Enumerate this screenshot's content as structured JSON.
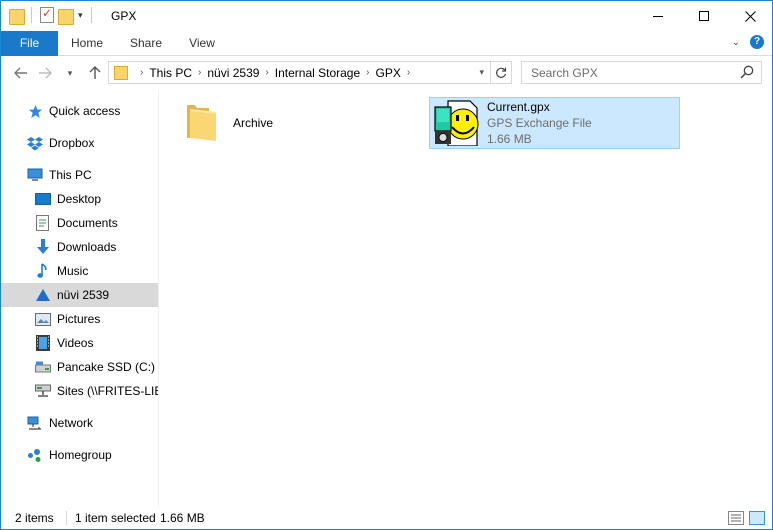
{
  "window": {
    "title": "GPX"
  },
  "ribbon": {
    "tabs": [
      "File",
      "Home",
      "Share",
      "View"
    ],
    "help": "?"
  },
  "nav": {
    "breadcrumbs": [
      "This PC",
      "nüvi 2539",
      "Internal Storage",
      "GPX"
    ],
    "search_placeholder": "Search GPX"
  },
  "sidebar": {
    "items": [
      {
        "label": "Quick access",
        "icon": "star-icon"
      },
      {
        "label": "Dropbox",
        "icon": "dropbox-icon"
      },
      {
        "label": "This PC",
        "icon": "computer-icon"
      },
      {
        "label": "Desktop",
        "icon": "desktop-icon"
      },
      {
        "label": "Documents",
        "icon": "documents-icon"
      },
      {
        "label": "Downloads",
        "icon": "download-arrow-icon"
      },
      {
        "label": "Music",
        "icon": "music-note-icon"
      },
      {
        "label": "nüvi 2539",
        "icon": "gps-device-icon",
        "selected": true
      },
      {
        "label": "Pictures",
        "icon": "pictures-icon"
      },
      {
        "label": "Videos",
        "icon": "film-icon"
      },
      {
        "label": "Pancake SSD (C:)",
        "icon": "drive-icon"
      },
      {
        "label": "Sites (\\\\FRITES-LIBE",
        "icon": "network-drive-icon"
      },
      {
        "label": "Network",
        "icon": "network-icon"
      },
      {
        "label": "Homegroup",
        "icon": "homegroup-icon"
      }
    ]
  },
  "files": [
    {
      "name": "Archive",
      "kind": "folder"
    },
    {
      "name": "Current.gpx",
      "type": "GPS Exchange File",
      "size": "1.66 MB",
      "selected": true
    }
  ],
  "status": {
    "count": "2 items",
    "selection": "1 item selected",
    "size": "1.66 MB"
  },
  "colors": {
    "accent": "#1979ca",
    "selection_bg": "#cce8ff",
    "selection_border": "#99d1ff",
    "folder": "#f9d46b",
    "sidebar_selected": "#d9d9d9"
  }
}
